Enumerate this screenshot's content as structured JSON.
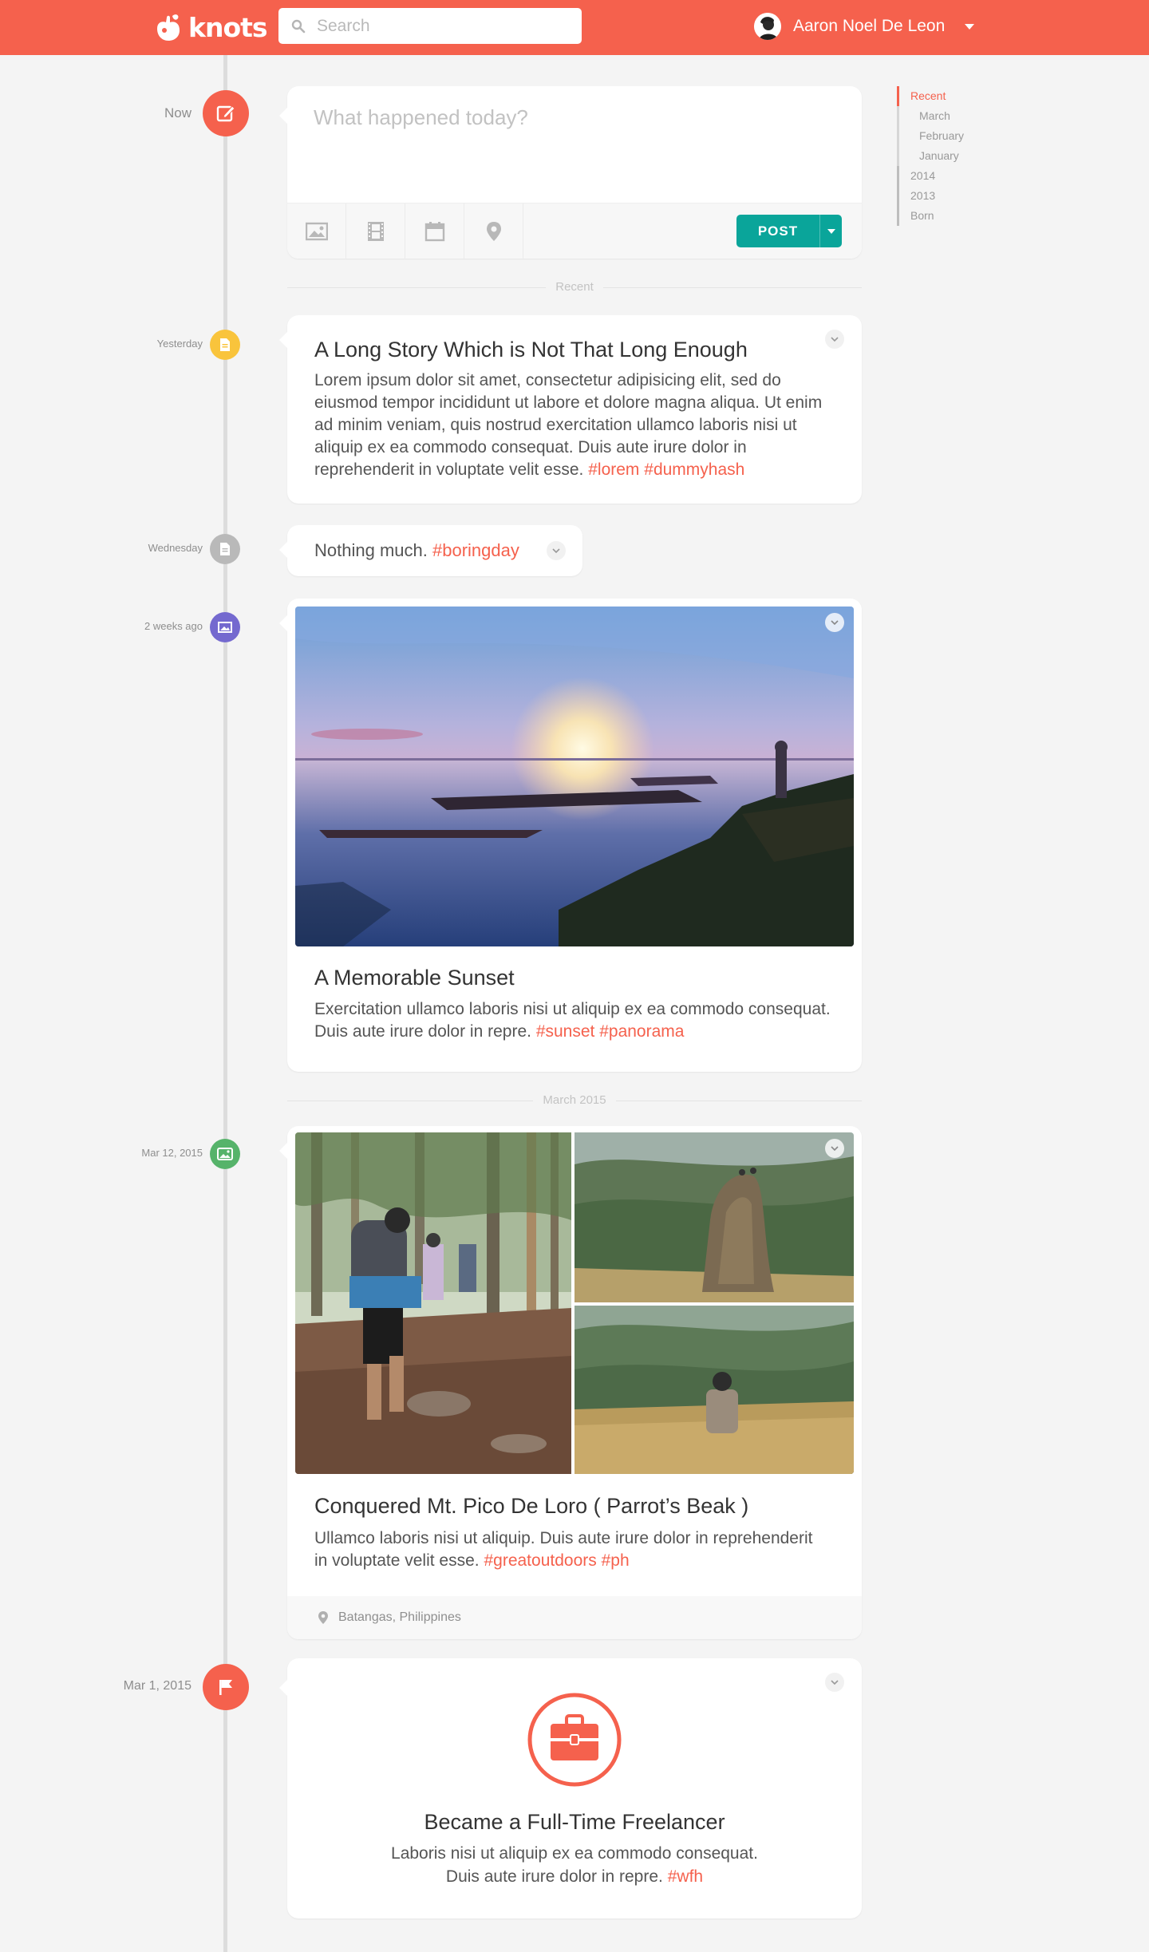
{
  "app": {
    "name": "knots"
  },
  "header": {
    "search_placeholder": "Search",
    "user_name": "Aaron Noel De Leon"
  },
  "composer": {
    "time_label": "Now",
    "placeholder": "What happened today?",
    "post_label": "POST",
    "tools": [
      "image-icon",
      "film-icon",
      "calendar-icon",
      "location-icon"
    ]
  },
  "separators": {
    "recent": "Recent",
    "march": "March 2015"
  },
  "sidebar": {
    "items": [
      {
        "label": "Recent",
        "active": true
      },
      {
        "label": "March"
      },
      {
        "label": "February"
      },
      {
        "label": "January"
      },
      {
        "label": "2014"
      },
      {
        "label": "2013"
      },
      {
        "label": "Born"
      }
    ]
  },
  "posts": {
    "story": {
      "time": "Yesterday",
      "title": "A Long Story Which is Not That Long Enough",
      "body": "Lorem ipsum dolor sit amet, consectetur adipisicing elit, sed do eiusmod tempor incididunt ut labore et dolore magna aliqua. Ut enim ad minim veniam, quis nostrud exercitation ullamco laboris nisi ut aliquip ex ea commodo consequat. Duis aute irure dolor in reprehenderit in voluptate velit esse.",
      "tags": [
        "#lorem",
        "#dummyhash"
      ],
      "accent": "#f9c43c"
    },
    "status": {
      "time": "Wednesday",
      "text": "Nothing much.",
      "tag": "#boringday",
      "accent": "#b9b9b9"
    },
    "sunset": {
      "time": "2 weeks ago",
      "title": "A Memorable Sunset",
      "body": "Exercitation ullamco laboris nisi ut aliquip ex ea commodo consequat. Duis aute irure dolor in repre.",
      "tags": [
        "#sunset",
        "#panorama"
      ],
      "accent": "#7469cf"
    },
    "hike": {
      "time": "Mar 12, 2015",
      "title": "Conquered Mt. Pico De Loro ( Parrot’s Beak )",
      "body": "Ullamco laboris nisi ut aliquip. Duis aute irure dolor in reprehenderit in voluptate velit esse.",
      "tags": [
        "#greatoutdoors",
        "#ph"
      ],
      "location": "Batangas, Philippines",
      "accent": "#56b36a"
    },
    "milestone": {
      "time": "Mar 1, 2015",
      "title": "Became a Full-Time Freelancer",
      "body_line1": "Laboris nisi ut aliquip ex ea commodo consequat.",
      "body_line2": "Duis aute irure dolor in repre.",
      "tag": "#wfh",
      "accent": "#f5614d"
    }
  },
  "colors": {
    "brand": "#f5614d",
    "post_button": "#0aa59a",
    "background": "#f4f4f4"
  }
}
